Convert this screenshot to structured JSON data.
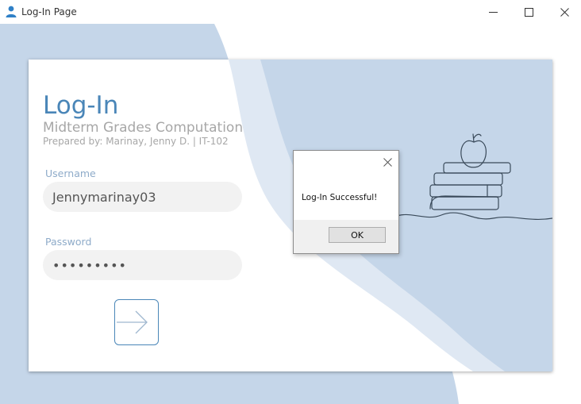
{
  "window": {
    "title": "Log-In Page",
    "icon": "user-icon"
  },
  "form": {
    "heading": "Log-In",
    "subtitle": "Midterm Grades Computation",
    "prepared_by": "Prepared by: Marinay, Jenny D. | IT-102",
    "username_label": "Username",
    "username_value": "Jennymarinay03",
    "password_label": "Password",
    "password_value": "•••••••••",
    "submit_icon": "login-arrow-icon"
  },
  "dialog": {
    "message": "Log-In Successful!",
    "ok_label": "OK"
  },
  "colors": {
    "accent": "#4a86b8",
    "panel_blue": "#c5d6e9",
    "wave_light": "#dfe8f3",
    "label_blue": "#8eabc9",
    "field_bg": "#f2f2f2"
  }
}
